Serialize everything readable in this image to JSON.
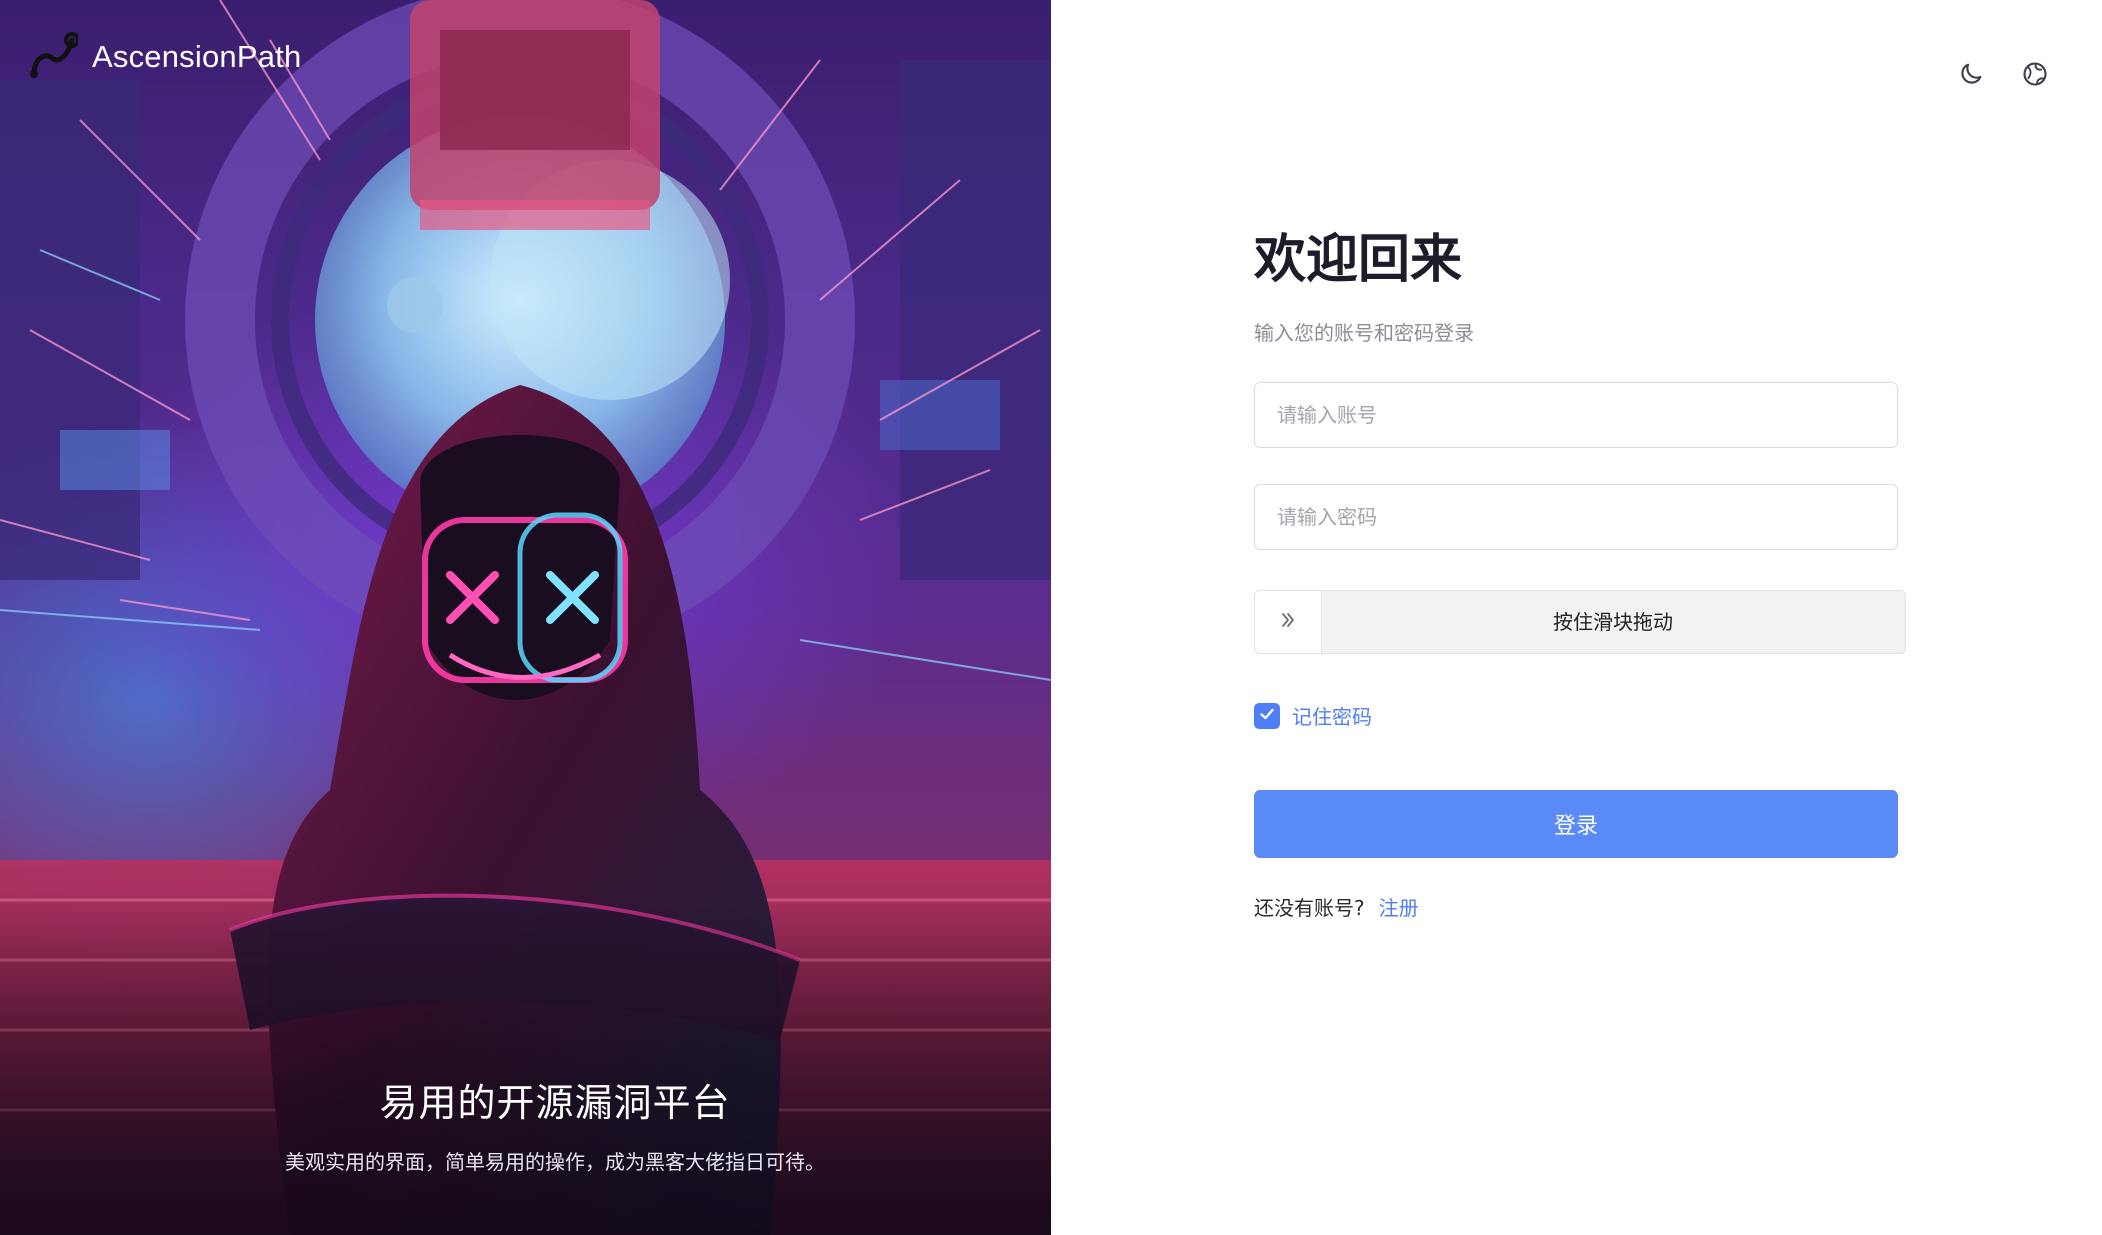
{
  "brand": {
    "name": "AscensionPath",
    "logo_icon": "route-logo-icon"
  },
  "hero": {
    "title": "易用的开源漏洞平台",
    "subtitle": "美观实用的界面，简单易用的操作，成为黑客大佬指日可待。"
  },
  "header": {
    "theme_toggle_icon": "moon-icon",
    "language_icon": "globe-icon"
  },
  "login": {
    "title": "欢迎回来",
    "subtitle": "输入您的账号和密码登录",
    "account_placeholder": "请输入账号",
    "password_placeholder": "请输入密码",
    "slider_text": "按住滑块拖动",
    "slider_icon": "double-chevron-right-icon",
    "remember_label": "记住密码",
    "remember_checked": true,
    "submit_label": "登录",
    "no_account_text": "还没有账号?",
    "register_link": "注册"
  },
  "colors": {
    "primary": "#5a89f8",
    "link": "#4f7df5",
    "title": "#1c1c2a"
  }
}
